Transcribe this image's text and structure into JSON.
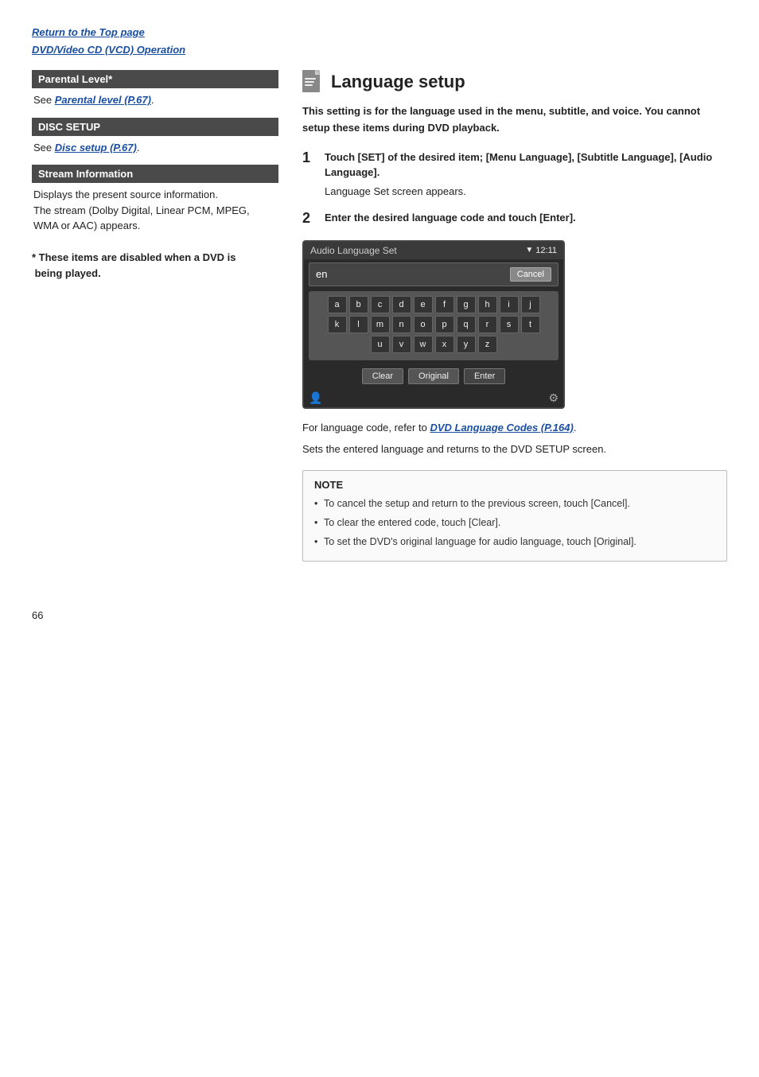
{
  "top_links": {
    "link1": "Return to the Top page",
    "link2": "DVD/Video CD (VCD) Operation"
  },
  "left_col": {
    "section1": {
      "header": "Parental Level*",
      "body_text": "See ",
      "link_text": "Parental level (P.67)",
      "link_href": "#"
    },
    "section2": {
      "header": "DISC SETUP",
      "body_text": "See ",
      "link_text": "Disc setup (P.67)",
      "link_href": "#"
    },
    "section3": {
      "header": "Stream Information",
      "body_line1": "Displays the present source information.",
      "body_line2": "The stream (Dolby Digital, Linear PCM, MPEG,",
      "body_line3": "WMA or AAC) appears."
    },
    "asterisk_note": "* These items are disabled when a DVD is\n being played."
  },
  "right_col": {
    "title": "Language setup",
    "intro": "This setting is for the language used in the menu, subtitle, and voice. You cannot setup these items during DVD playback.",
    "step1": {
      "num": "1",
      "title": "Touch [SET] of the desired item; [Menu Language], [Subtitle Language], [Audio Language].",
      "sub": "Language Set screen appears."
    },
    "step2": {
      "num": "2",
      "title": "Enter the desired language code and touch [Enter]."
    },
    "screen": {
      "title": "Audio Language Set",
      "time": "12:11",
      "input_value": "en",
      "cancel_label": "Cancel",
      "keyboard_rows": [
        [
          "a",
          "b",
          "c",
          "d",
          "e",
          "f",
          "g",
          "h",
          "i",
          "j"
        ],
        [
          "k",
          "l",
          "m",
          "n",
          "o",
          "p",
          "q",
          "r",
          "s",
          "t"
        ],
        [
          "u",
          "v",
          "w",
          "x",
          "y",
          "z"
        ]
      ],
      "clear_label": "Clear",
      "original_label": "Original",
      "enter_label": "Enter"
    },
    "ref_text_prefix": "For language code, refer to ",
    "ref_link_text": "DVD Language Codes (P.164)",
    "ref_link_href": "#",
    "ref_text_suffix": ".",
    "sets_text": "Sets the entered language and returns to the DVD SETUP screen.",
    "note": {
      "title": "NOTE",
      "items": [
        "To cancel the setup and return to the previous screen, touch [Cancel].",
        "To clear the entered code, touch [Clear].",
        "To set the DVD's original language for audio language, touch [Original]."
      ]
    }
  },
  "page_number": "66"
}
